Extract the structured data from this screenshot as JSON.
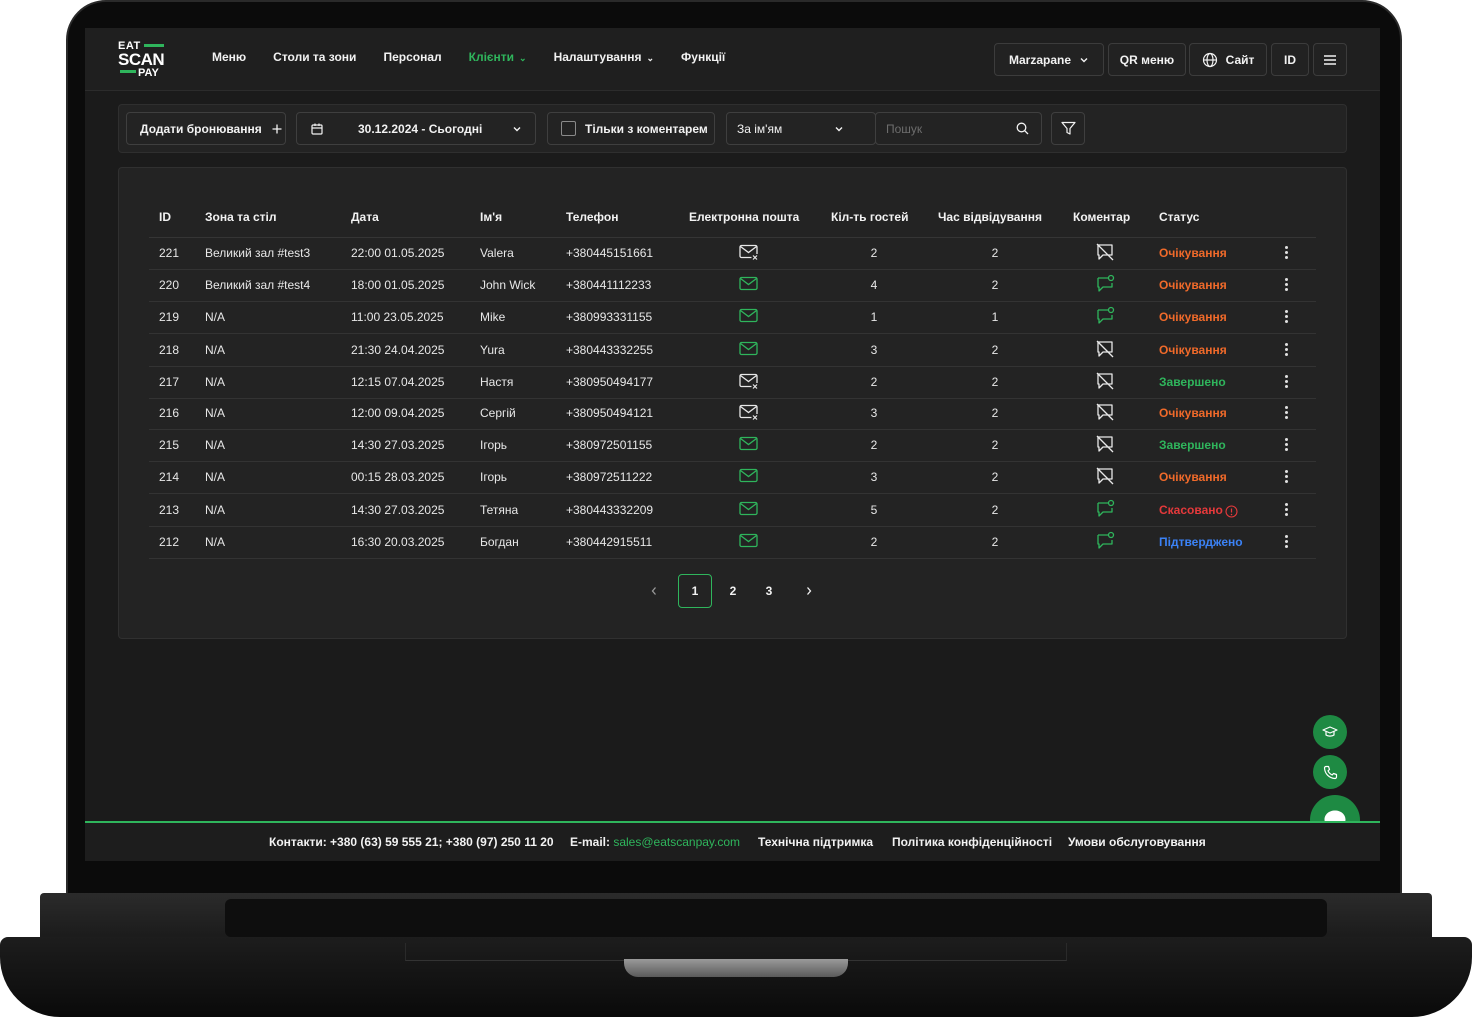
{
  "logo": {
    "line1": "EAT",
    "line2": "SCAN",
    "line3": "PAY"
  },
  "nav": {
    "menu": "Меню",
    "tables": "Столи та зони",
    "staff": "Персонал",
    "clients": "Клієнти",
    "settings": "Налаштування",
    "functions": "Функції"
  },
  "topbar": {
    "restaurant": "Marzapane",
    "qr_menu": "QR меню",
    "site": "Сайт",
    "id": "ID"
  },
  "filters": {
    "add_booking": "Додати бронювання",
    "date_range": "30.12.2024 - Сьогодні",
    "only_with_comment": "Тільки з коментарем",
    "search_by": "За ім'ям",
    "search_placeholder": "Пошук"
  },
  "table": {
    "headers": {
      "id": "ID",
      "zone": "Зона та стіл",
      "date": "Дата",
      "name": "Ім'я",
      "phone": "Телефон",
      "email": "Електронна пошта",
      "guests": "Кіл-ть гостей",
      "visit_time": "Час відвідування",
      "comment": "Коментар",
      "status": "Статус"
    },
    "rows": [
      {
        "id": "221",
        "zone": "Великий зал #test3",
        "date": "22:00 01.05.2025",
        "name": "Valera",
        "phone": "+380445151661",
        "email_icon": "mail-off-icon",
        "guests": "2",
        "visit_time": "2",
        "comment_icon": "comment-off-icon",
        "status": "Очікування",
        "status_color": "#f06a2a"
      },
      {
        "id": "220",
        "zone": "Великий зал #test4",
        "date": "18:00 01.05.2025",
        "name": "John Wick",
        "phone": "+380441112233",
        "email_icon": "mail-icon",
        "guests": "4",
        "visit_time": "2",
        "comment_icon": "comment-icon",
        "status": "Очікування",
        "status_color": "#f06a2a"
      },
      {
        "id": "219",
        "zone": "N/A",
        "date": "11:00 23.05.2025",
        "name": "Mike",
        "phone": "+380993331155",
        "email_icon": "mail-icon",
        "guests": "1",
        "visit_time": "1",
        "comment_icon": "comment-icon",
        "status": "Очікування",
        "status_color": "#f06a2a"
      },
      {
        "id": "218",
        "zone": "N/A",
        "date": "21:30 24.04.2025",
        "name": "Yura",
        "phone": "+380443332255",
        "email_icon": "mail-icon",
        "guests": "3",
        "visit_time": "2",
        "comment_icon": "comment-off-icon",
        "status": "Очікування",
        "status_color": "#f06a2a"
      },
      {
        "id": "217",
        "zone": "N/A",
        "date": "12:15 07.04.2025",
        "name": "Настя",
        "phone": "+380950494177",
        "email_icon": "mail-off-icon",
        "guests": "2",
        "visit_time": "2",
        "comment_icon": "comment-off-icon",
        "status": "Завершено",
        "status_color": "#2fb55c"
      },
      {
        "id": "216",
        "zone": "N/A",
        "date": "12:00 09.04.2025",
        "name": "Сергій",
        "phone": "+380950494121",
        "email_icon": "mail-off-icon",
        "guests": "3",
        "visit_time": "2",
        "comment_icon": "comment-off-icon",
        "status": "Очікування",
        "status_color": "#f06a2a"
      },
      {
        "id": "215",
        "zone": "N/A",
        "date": "14:30 27.03.2025",
        "name": "Ігорь",
        "phone": "+380972501155",
        "email_icon": "mail-icon",
        "guests": "2",
        "visit_time": "2",
        "comment_icon": "comment-off-icon",
        "status": "Завершено",
        "status_color": "#2fb55c"
      },
      {
        "id": "214",
        "zone": "N/A",
        "date": "00:15 28.03.2025",
        "name": "Ігорь",
        "phone": "+380972511222",
        "email_icon": "mail-icon",
        "guests": "3",
        "visit_time": "2",
        "comment_icon": "comment-off-icon",
        "status": "Очікування",
        "status_color": "#f06a2a"
      },
      {
        "id": "213",
        "zone": "N/A",
        "date": "14:30 27.03.2025",
        "name": "Тетяна",
        "phone": "+380443332209",
        "email_icon": "mail-icon",
        "guests": "5",
        "visit_time": "2",
        "comment_icon": "comment-icon",
        "status": "Скасовано",
        "status_color": "#e5393b",
        "status_info": true
      },
      {
        "id": "212",
        "zone": "N/A",
        "date": "16:30 20.03.2025",
        "name": "Богдан",
        "phone": "+380442915511",
        "email_icon": "mail-icon",
        "guests": "2",
        "visit_time": "2",
        "comment_icon": "comment-icon",
        "status": "Підтверджено",
        "status_color": "#3b82f6"
      }
    ]
  },
  "pagination": {
    "pages": [
      "1",
      "2",
      "3"
    ],
    "current": "1"
  },
  "footer": {
    "contacts": "Контакти: +380 (63) 59 555 21; +380 (97) 250 11 20",
    "email_label": "E-mail: ",
    "email": "sales@eatscanpay.com",
    "support": "Технічна підтримка",
    "privacy": "Політика конфіденційності",
    "terms": "Умови обслуговування"
  },
  "colors": {
    "accent": "#2fb55c",
    "pending": "#f06a2a",
    "done": "#2fb55c",
    "cancelled": "#e5393b",
    "confirmed": "#3b82f6"
  }
}
